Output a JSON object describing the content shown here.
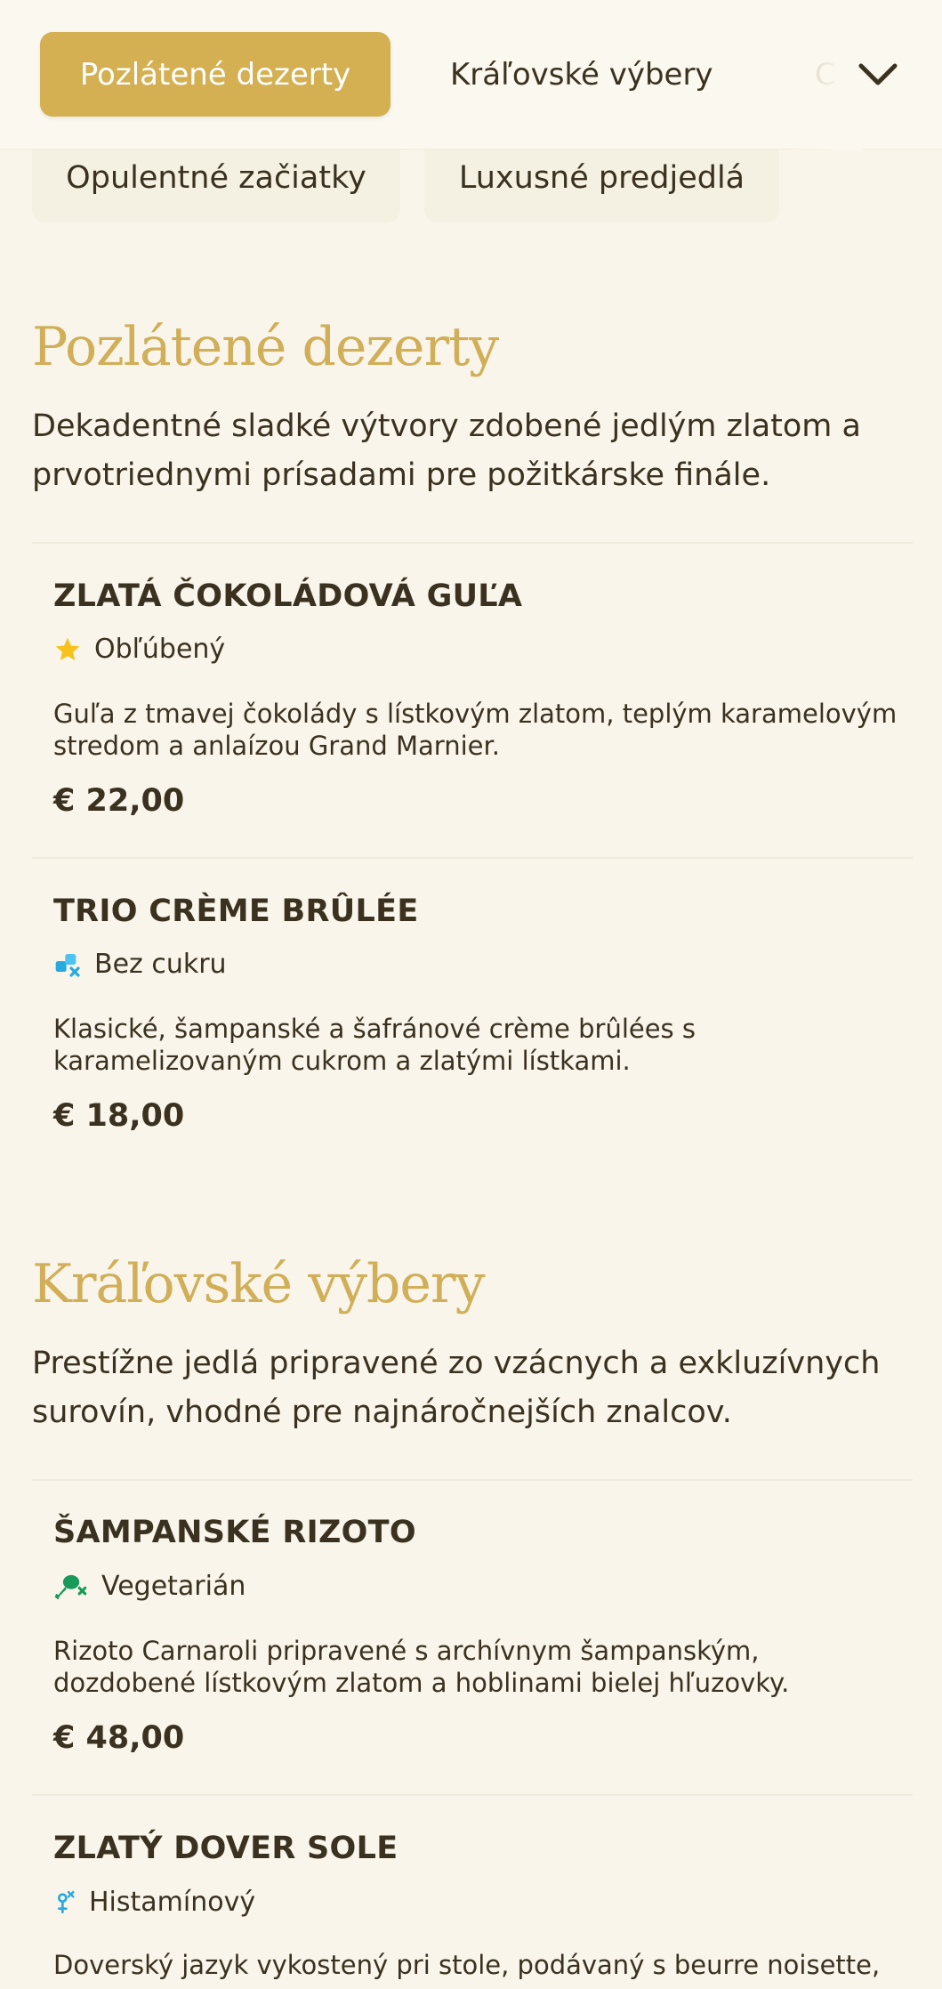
{
  "nav": {
    "tabs": [
      {
        "label": "Pozlátené dezerty",
        "active": true
      },
      {
        "label": "Kráľovské výbery",
        "active": false
      },
      {
        "label": "C",
        "active": false
      }
    ],
    "second_row": [
      {
        "label": "Opulentné začiatky"
      },
      {
        "label": "Luxusné predjedlá"
      }
    ],
    "expand_icon": "chevron-down-icon"
  },
  "sections": [
    {
      "title": "Pozlátené dezerty",
      "description": "Dekadentné sladké výtvory zdobené jedlým zlatom a prvotriednymi prísadami pre požitkárske finále.",
      "items": [
        {
          "name": "ZLATÁ ČOKOLÁDOVÁ GUĽA",
          "tag": "Obľúbený",
          "tag_icon": "star-icon",
          "description": "Guľa z tmavej čokolády s lístkovým zlatom, teplým karamelovým stredom a anlaízou Grand Marnier.",
          "price": "€ 22,00"
        },
        {
          "name": "TRIO CRÈME BRÛLÉE",
          "tag": "Bez cukru",
          "tag_icon": "sugar-free-icon",
          "description": "Klasické, šampanské a šafránové crème brûlées s karamelizovaným cukrom a zlatými lístkami.",
          "price": "€ 18,00"
        }
      ]
    },
    {
      "title": "Kráľovské výbery",
      "description": "Prestížne jedlá pripravené zo vzácnych a exkluzívnych surovín, vhodné pre najnáročnejších znalcov.",
      "items": [
        {
          "name": "ŠAMPANSKÉ RIZOTO",
          "tag": "Vegetarián",
          "tag_icon": "no-meat-icon",
          "description": "Rizoto Carnaroli pripravené s archívnym šampanským, dozdobené lístkovým zlatom a hoblinami bielej hľuzovky.",
          "price": "€ 48,00"
        },
        {
          "name": "ZLATÝ DOVER SOLE",
          "tag": "Histamínový",
          "tag_icon": "histamine-icon",
          "description": "Doverský jazyk vykostený pri stole, podávaný s beurre noisette,",
          "price": ""
        }
      ]
    }
  ],
  "colors": {
    "background": "#f9f5ea",
    "accent": "#d4b052",
    "title_gold": "#d1ae58",
    "text": "#3a3120"
  }
}
